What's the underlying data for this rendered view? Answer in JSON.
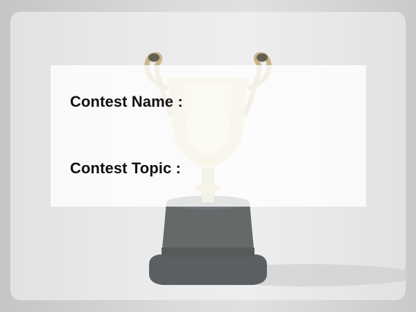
{
  "form": {
    "contest_name_label": "Contest Name :",
    "contest_name_value": "",
    "contest_topic_label": "Contest Topic :",
    "contest_topic_value": ""
  },
  "background": {
    "image_icon": "trophy-icon"
  },
  "colors": {
    "label_text": "#111111",
    "panel_bg": "#ffffff"
  }
}
